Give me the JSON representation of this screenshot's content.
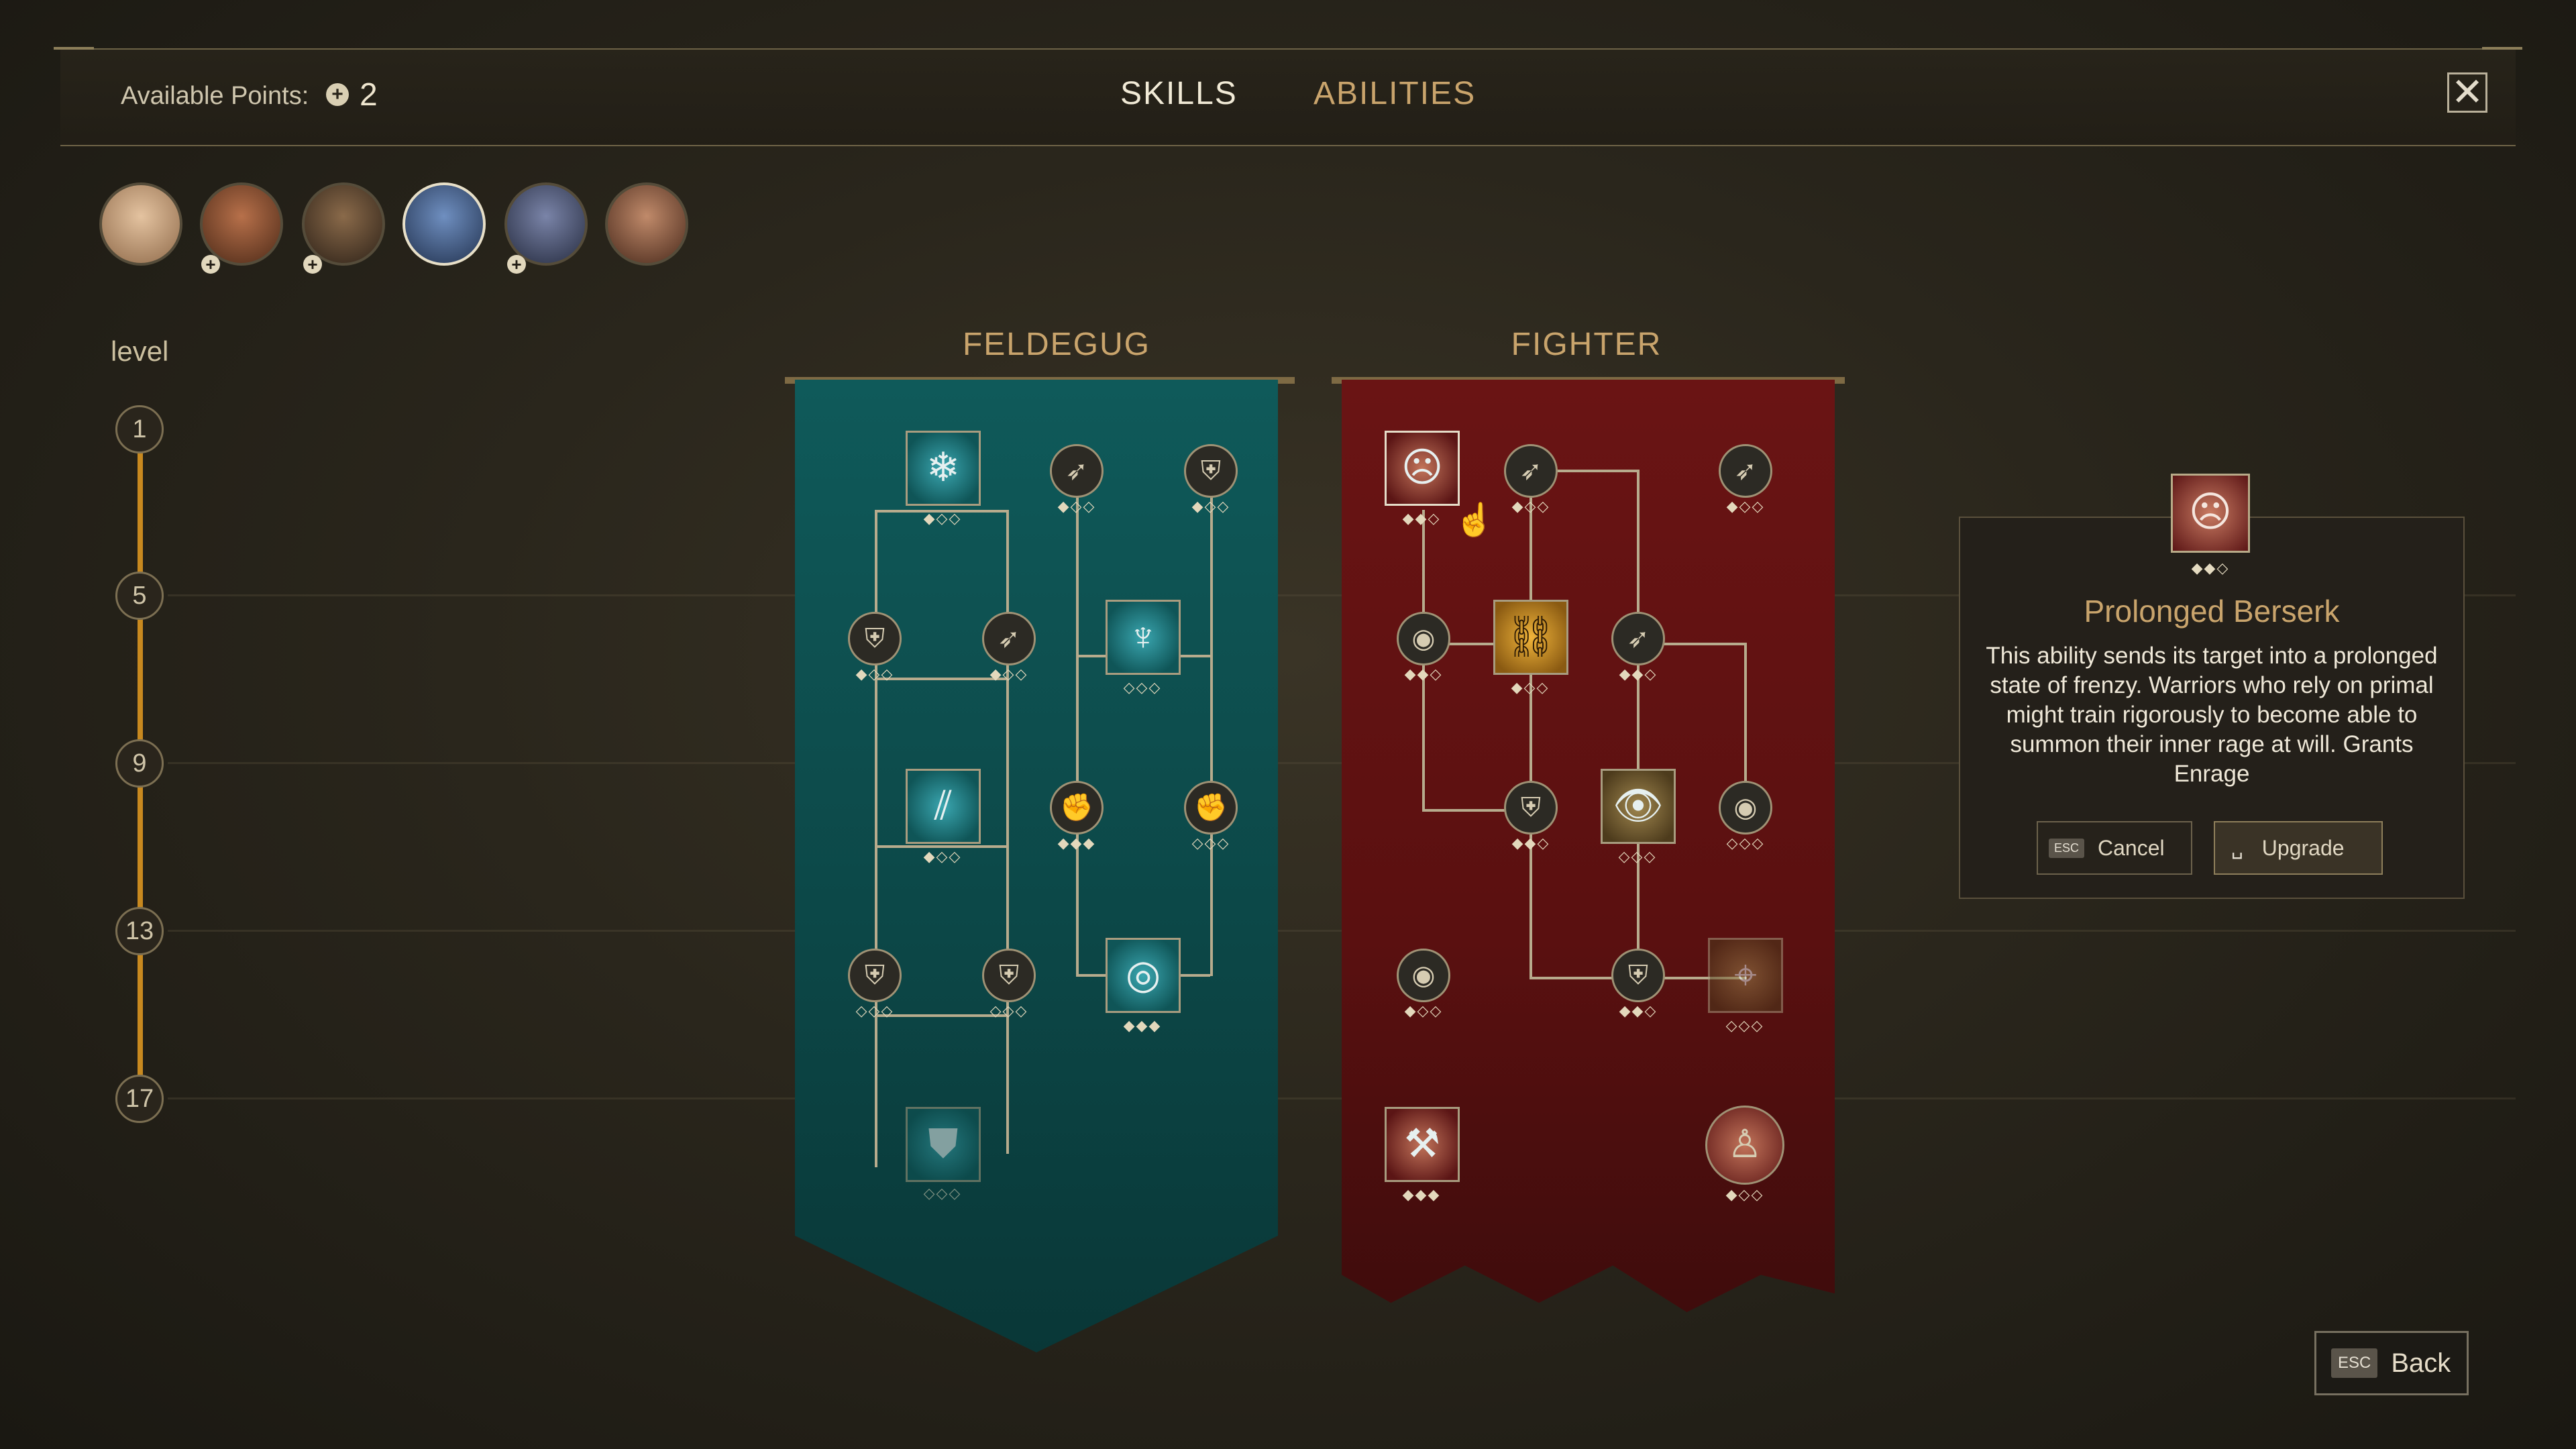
{
  "header": {
    "points_label": "Available Points:",
    "points_icon": "plus-circle-icon",
    "points_value": "2",
    "tabs": [
      {
        "label": "SKILLS",
        "active": true
      },
      {
        "label": "ABILITIES",
        "active": false
      }
    ],
    "close_icon": "close-icon"
  },
  "party": [
    {
      "name": "portrait-1",
      "has_points": false,
      "selected": false,
      "color": "#c99d78"
    },
    {
      "name": "portrait-2",
      "has_points": true,
      "selected": false,
      "color": "#8a4a2c"
    },
    {
      "name": "portrait-3",
      "has_points": true,
      "selected": false,
      "color": "#5e4732"
    },
    {
      "name": "portrait-4",
      "has_points": false,
      "selected": true,
      "color": "#3c5a86"
    },
    {
      "name": "portrait-5",
      "has_points": true,
      "selected": false,
      "color": "#4e5a7a"
    },
    {
      "name": "portrait-6",
      "has_points": false,
      "selected": false,
      "color": "#8a5a42"
    }
  ],
  "levels": {
    "label": "level",
    "values": [
      "1",
      "5",
      "9",
      "13",
      "17"
    ]
  },
  "trees": [
    {
      "title": "FELDEGUG",
      "color": "#0f5a5a"
    },
    {
      "title": "FIGHTER",
      "color": "#6a1414"
    }
  ],
  "tooltip": {
    "icon": "berserk-face-icon",
    "pips": "◆◆◇",
    "title": "Prolonged Berserk",
    "description": "This ability sends its target into a prolonged state of frenzy. Warriors who rely on primal might train rigorously to become able to summon their inner rage at will. Grants Enrage",
    "cancel_key": "ESC",
    "cancel_label": "Cancel",
    "upgrade_key": "␣",
    "upgrade_label": "Upgrade"
  },
  "footer": {
    "back_key": "ESC",
    "back_label": "Back"
  },
  "nodes_pips": {
    "full": "◆◆◆",
    "two": "◆◆◇",
    "one": "◆◇◇",
    "zero": "◇◇◇"
  }
}
